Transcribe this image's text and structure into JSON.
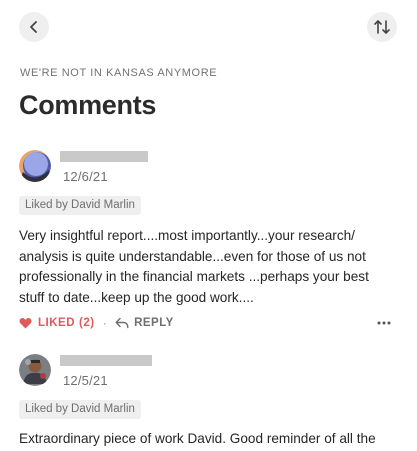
{
  "header": {
    "back_icon": "chevron-left-icon",
    "sort_icon": "sort-arrows-icon",
    "publication": "WE'RE NOT IN KANSAS ANYMORE",
    "title": "Comments"
  },
  "comments": [
    {
      "date": "12/6/21",
      "liked_by": "Liked by David Marlin",
      "text": "Very insightful report....most importantly...your research/ analysis is quite understandable...even for those of us not professionally in the financial markets ...perhaps your best stuff to date...keep up the good work....",
      "like_label": "LIKED",
      "like_count": "(2)",
      "separator": "·",
      "reply_label": "REPLY",
      "more_label": "···"
    },
    {
      "date": "12/5/21",
      "liked_by": "Liked by David Marlin",
      "text": "Extraordinary piece of work David. Good reminder of all the"
    }
  ],
  "colors": {
    "liked_accent": "#e05a5a",
    "button_bg": "#efefef",
    "muted_text": "#6f6f6f"
  }
}
